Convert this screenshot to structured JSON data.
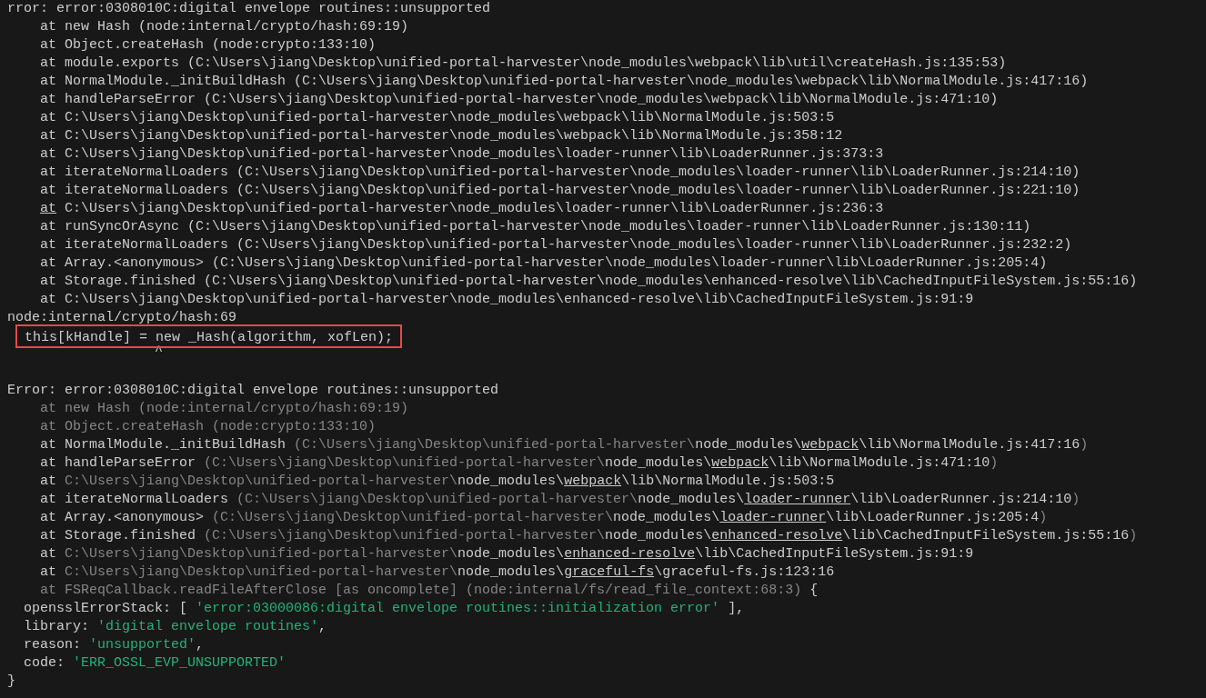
{
  "terminal": {
    "lines": [
      {
        "kind": "plain",
        "segments": [
          {
            "text": "rror: error:0308010C:digital envelope routines::unsupported",
            "kind": "normal"
          }
        ]
      },
      {
        "kind": "frame",
        "segments": [
          {
            "text": "at new Hash (node:internal/crypto/hash:69:19)",
            "kind": "normal"
          }
        ]
      },
      {
        "kind": "frame",
        "segments": [
          {
            "text": "at Object.createHash (node:crypto:133:10)",
            "kind": "normal"
          }
        ]
      },
      {
        "kind": "frame",
        "segments": [
          {
            "text": "at module.exports (C:\\Users\\jiang\\Desktop\\unified-portal-harvester\\node_modules\\webpack\\lib\\util\\createHash.js:135:53)",
            "kind": "normal"
          }
        ]
      },
      {
        "kind": "frame",
        "segments": [
          {
            "text": "at NormalModule._initBuildHash (C:\\Users\\jiang\\Desktop\\unified-portal-harvester\\node_modules\\webpack\\lib\\NormalModule.js:417:16)",
            "kind": "normal"
          }
        ]
      },
      {
        "kind": "frame",
        "segments": [
          {
            "text": "at handleParseError (C:\\Users\\jiang\\Desktop\\unified-portal-harvester\\node_modules\\webpack\\lib\\NormalModule.js:471:10)",
            "kind": "normal"
          }
        ]
      },
      {
        "kind": "frame",
        "segments": [
          {
            "text": "at C:\\Users\\jiang\\Desktop\\unified-portal-harvester\\node_modules\\webpack\\lib\\NormalModule.js:503:5",
            "kind": "normal"
          }
        ]
      },
      {
        "kind": "frame",
        "segments": [
          {
            "text": "at C:\\Users\\jiang\\Desktop\\unified-portal-harvester\\node_modules\\webpack\\lib\\NormalModule.js:358:12",
            "kind": "normal"
          }
        ]
      },
      {
        "kind": "frame",
        "segments": [
          {
            "text": "at C:\\Users\\jiang\\Desktop\\unified-portal-harvester\\node_modules\\loader-runner\\lib\\LoaderRunner.js:373:3",
            "kind": "normal"
          }
        ]
      },
      {
        "kind": "frame",
        "segments": [
          {
            "text": "at iterateNormalLoaders (C:\\Users\\jiang\\Desktop\\unified-portal-harvester\\node_modules\\loader-runner\\lib\\LoaderRunner.js:214:10)",
            "kind": "normal"
          }
        ]
      },
      {
        "kind": "frame",
        "segments": [
          {
            "text": "at iterateNormalLoaders (C:\\Users\\jiang\\Desktop\\unified-portal-harvester\\node_modules\\loader-runner\\lib\\LoaderRunner.js:221:10)",
            "kind": "normal"
          }
        ]
      },
      {
        "kind": "frame",
        "segments": [
          {
            "text": "at",
            "kind": "link"
          },
          {
            "text": " C:\\Users\\jiang\\Desktop\\unified-portal-harvester\\node_modules\\loader-runner\\lib\\LoaderRunner.js:236:3",
            "kind": "normal"
          }
        ]
      },
      {
        "kind": "frame",
        "segments": [
          {
            "text": "at runSyncOrAsync (C:\\Users\\jiang\\Desktop\\unified-portal-harvester\\node_modules\\loader-runner\\lib\\LoaderRunner.js:130:11)",
            "kind": "normal"
          }
        ]
      },
      {
        "kind": "frame",
        "segments": [
          {
            "text": "at iterateNormalLoaders (C:\\Users\\jiang\\Desktop\\unified-portal-harvester\\node_modules\\loader-runner\\lib\\LoaderRunner.js:232:2)",
            "kind": "normal"
          }
        ]
      },
      {
        "kind": "frame",
        "segments": [
          {
            "text": "at Array.<anonymous> (C:\\Users\\jiang\\Desktop\\unified-portal-harvester\\node_modules\\loader-runner\\lib\\LoaderRunner.js:205:4)",
            "kind": "normal"
          }
        ]
      },
      {
        "kind": "frame",
        "segments": [
          {
            "text": "at Storage.finished (C:\\Users\\jiang\\Desktop\\unified-portal-harvester\\node_modules\\enhanced-resolve\\lib\\CachedInputFileSystem.js:55:16)",
            "kind": "normal"
          }
        ]
      },
      {
        "kind": "frame",
        "segments": [
          {
            "text": "at C:\\Users\\jiang\\Desktop\\unified-portal-harvester\\node_modules\\enhanced-resolve\\lib\\CachedInputFileSystem.js:91:9",
            "kind": "normal"
          }
        ]
      },
      {
        "kind": "plain",
        "segments": [
          {
            "text": "node:internal/crypto/hash:69",
            "kind": "normal"
          }
        ]
      },
      {
        "kind": "highlighted",
        "segments": [
          {
            "text": "this[kHandle] = new _Hash(algorithm, xofLen);",
            "kind": "normal"
          }
        ]
      },
      {
        "kind": "caret",
        "segments": [
          {
            "text": "^",
            "kind": "normal"
          }
        ]
      },
      {
        "kind": "blank"
      },
      {
        "kind": "plain",
        "segments": [
          {
            "text": "Error: error:0308010C:digital envelope routines::unsupported",
            "kind": "normal"
          }
        ]
      },
      {
        "kind": "frame",
        "segments": [
          {
            "text": "at new Hash (node:internal/crypto/hash:69:19)",
            "kind": "dim"
          }
        ]
      },
      {
        "kind": "frame",
        "segments": [
          {
            "text": "at Object.createHash (node:crypto:133:10)",
            "kind": "dim"
          }
        ]
      },
      {
        "kind": "frame",
        "segments": [
          {
            "text": "at NormalModule._initBuildHash ",
            "kind": "normal"
          },
          {
            "text": "(C:\\Users\\jiang\\Desktop\\unified-portal-harvester\\",
            "kind": "dim"
          },
          {
            "text": "node_modules\\",
            "kind": "normal"
          },
          {
            "text": "webpack",
            "kind": "link"
          },
          {
            "text": "\\lib\\NormalModule.js:417:16",
            "kind": "normal"
          },
          {
            "text": ")",
            "kind": "dim"
          }
        ]
      },
      {
        "kind": "frame",
        "segments": [
          {
            "text": "at handleParseError ",
            "kind": "normal"
          },
          {
            "text": "(C:\\Users\\jiang\\Desktop\\unified-portal-harvester\\",
            "kind": "dim"
          },
          {
            "text": "node_modules\\",
            "kind": "normal"
          },
          {
            "text": "webpack",
            "kind": "link"
          },
          {
            "text": "\\lib\\NormalModule.js:471:10",
            "kind": "normal"
          },
          {
            "text": ")",
            "kind": "dim"
          }
        ]
      },
      {
        "kind": "frame",
        "segments": [
          {
            "text": "at ",
            "kind": "normal"
          },
          {
            "text": "C:\\Users\\jiang\\Desktop\\unified-portal-harvester\\",
            "kind": "dim"
          },
          {
            "text": "node_modules\\",
            "kind": "normal"
          },
          {
            "text": "webpack",
            "kind": "link"
          },
          {
            "text": "\\lib\\NormalModule.js:503:5",
            "kind": "normal"
          }
        ]
      },
      {
        "kind": "frame",
        "segments": [
          {
            "text": "at iterateNormalLoaders ",
            "kind": "normal"
          },
          {
            "text": "(C:\\Users\\jiang\\Desktop\\unified-portal-harvester\\",
            "kind": "dim"
          },
          {
            "text": "node_modules\\",
            "kind": "normal"
          },
          {
            "text": "loader-runner",
            "kind": "link"
          },
          {
            "text": "\\lib\\LoaderRunner.js:214:10",
            "kind": "normal"
          },
          {
            "text": ")",
            "kind": "dim"
          }
        ]
      },
      {
        "kind": "frame",
        "segments": [
          {
            "text": "at Array.<anonymous> ",
            "kind": "normal"
          },
          {
            "text": "(C:\\Users\\jiang\\Desktop\\unified-portal-harvester\\",
            "kind": "dim"
          },
          {
            "text": "node_modules\\",
            "kind": "normal"
          },
          {
            "text": "loader-runner",
            "kind": "link"
          },
          {
            "text": "\\lib\\LoaderRunner.js:205:4",
            "kind": "normal"
          },
          {
            "text": ")",
            "kind": "dim"
          }
        ]
      },
      {
        "kind": "frame",
        "segments": [
          {
            "text": "at Storage.finished ",
            "kind": "normal"
          },
          {
            "text": "(C:\\Users\\jiang\\Desktop\\unified-portal-harvester\\",
            "kind": "dim"
          },
          {
            "text": "node_modules\\",
            "kind": "normal"
          },
          {
            "text": "enhanced-resolve",
            "kind": "link"
          },
          {
            "text": "\\lib\\CachedInputFileSystem.js:55:16",
            "kind": "normal"
          },
          {
            "text": ")",
            "kind": "dim"
          }
        ]
      },
      {
        "kind": "frame",
        "segments": [
          {
            "text": "at ",
            "kind": "normal"
          },
          {
            "text": "C:\\Users\\jiang\\Desktop\\unified-portal-harvester\\",
            "kind": "dim"
          },
          {
            "text": "node_modules\\",
            "kind": "normal"
          },
          {
            "text": "enhanced-resolve",
            "kind": "link"
          },
          {
            "text": "\\lib\\CachedInputFileSystem.js:91:9",
            "kind": "normal"
          }
        ]
      },
      {
        "kind": "frame",
        "segments": [
          {
            "text": "at ",
            "kind": "normal"
          },
          {
            "text": "C:\\Users\\jiang\\Desktop\\unified-portal-harvester\\",
            "kind": "dim"
          },
          {
            "text": "node_modules\\",
            "kind": "normal"
          },
          {
            "text": "graceful-fs",
            "kind": "link"
          },
          {
            "text": "\\graceful-fs.js:123:16",
            "kind": "normal"
          }
        ]
      },
      {
        "kind": "frame",
        "segments": [
          {
            "text": "at FSReqCallback.readFileAfterClose [as oncomplete] (node:internal/fs/read_file_context:68:3)",
            "kind": "dim"
          },
          {
            "text": " {",
            "kind": "normal"
          }
        ]
      },
      {
        "kind": "property",
        "segments": [
          {
            "text": "opensslErrorStack: [ ",
            "kind": "normal"
          },
          {
            "text": "'error:03000086:digital envelope routines::initialization error'",
            "kind": "string"
          },
          {
            "text": " ],",
            "kind": "normal"
          }
        ]
      },
      {
        "kind": "property",
        "segments": [
          {
            "text": "library: ",
            "kind": "normal"
          },
          {
            "text": "'digital envelope routines'",
            "kind": "string"
          },
          {
            "text": ",",
            "kind": "normal"
          }
        ]
      },
      {
        "kind": "property",
        "segments": [
          {
            "text": "reason: ",
            "kind": "normal"
          },
          {
            "text": "'unsupported'",
            "kind": "string"
          },
          {
            "text": ",",
            "kind": "normal"
          }
        ]
      },
      {
        "kind": "property",
        "segments": [
          {
            "text": "code: ",
            "kind": "normal"
          },
          {
            "text": "'ERR_OSSL_EVP_UNSUPPORTED'",
            "kind": "string"
          }
        ]
      },
      {
        "kind": "plain",
        "segments": [
          {
            "text": "}",
            "kind": "normal"
          }
        ]
      }
    ]
  }
}
